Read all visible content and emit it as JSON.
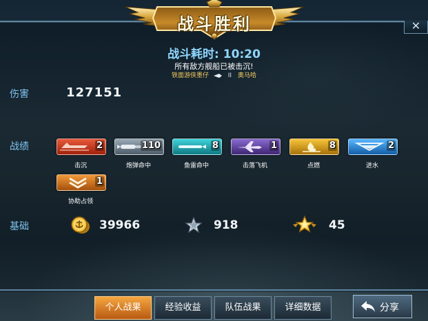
{
  "title": "战斗胜利",
  "close_symbol": "✕",
  "battle_time": {
    "label": "战斗耗时:",
    "value": "10:20"
  },
  "result_message": "所有敌方舰船已被击沉!",
  "kill_feed": {
    "attacker": "铁面游侠墨仔",
    "separator": "II",
    "victim": "奥马哈"
  },
  "damage": {
    "label": "伤害",
    "value": "127151"
  },
  "record": {
    "label": "战绩",
    "medals": [
      {
        "name": "击沉",
        "count": "2",
        "icon": "sunk-ship-icon",
        "color": "#c8331c"
      },
      {
        "name": "炮弹命中",
        "count": "110",
        "icon": "shell-hit-icon",
        "color": "#6b7c8c"
      },
      {
        "name": "鱼雷命中",
        "count": "8",
        "icon": "torpedo-hit-icon",
        "color": "#1fa6b0"
      },
      {
        "name": "击落飞机",
        "count": "1",
        "icon": "plane-shotdown-icon",
        "color": "#5a3f9a"
      },
      {
        "name": "点燃",
        "count": "8",
        "icon": "fire-icon",
        "color": "#d9a018"
      },
      {
        "name": "进水",
        "count": "2",
        "icon": "flooding-icon",
        "color": "#2f8ed8"
      },
      {
        "name": "协助占领",
        "count": "1",
        "icon": "assist-capture-icon",
        "color": "#e0781e"
      }
    ]
  },
  "base": {
    "label": "基础",
    "items": [
      {
        "icon": "gold-coin-icon",
        "value": "39966"
      },
      {
        "icon": "silver-star-icon",
        "value": "918"
      },
      {
        "icon": "gold-star-wings-icon",
        "value": "45"
      }
    ]
  },
  "tabs": [
    {
      "label": "个人战果",
      "active": true
    },
    {
      "label": "经验收益",
      "active": false
    },
    {
      "label": "队伍战果",
      "active": false
    },
    {
      "label": "详细数据",
      "active": false
    }
  ],
  "share": {
    "label": "分享",
    "icon": "share-arrow-icon"
  }
}
